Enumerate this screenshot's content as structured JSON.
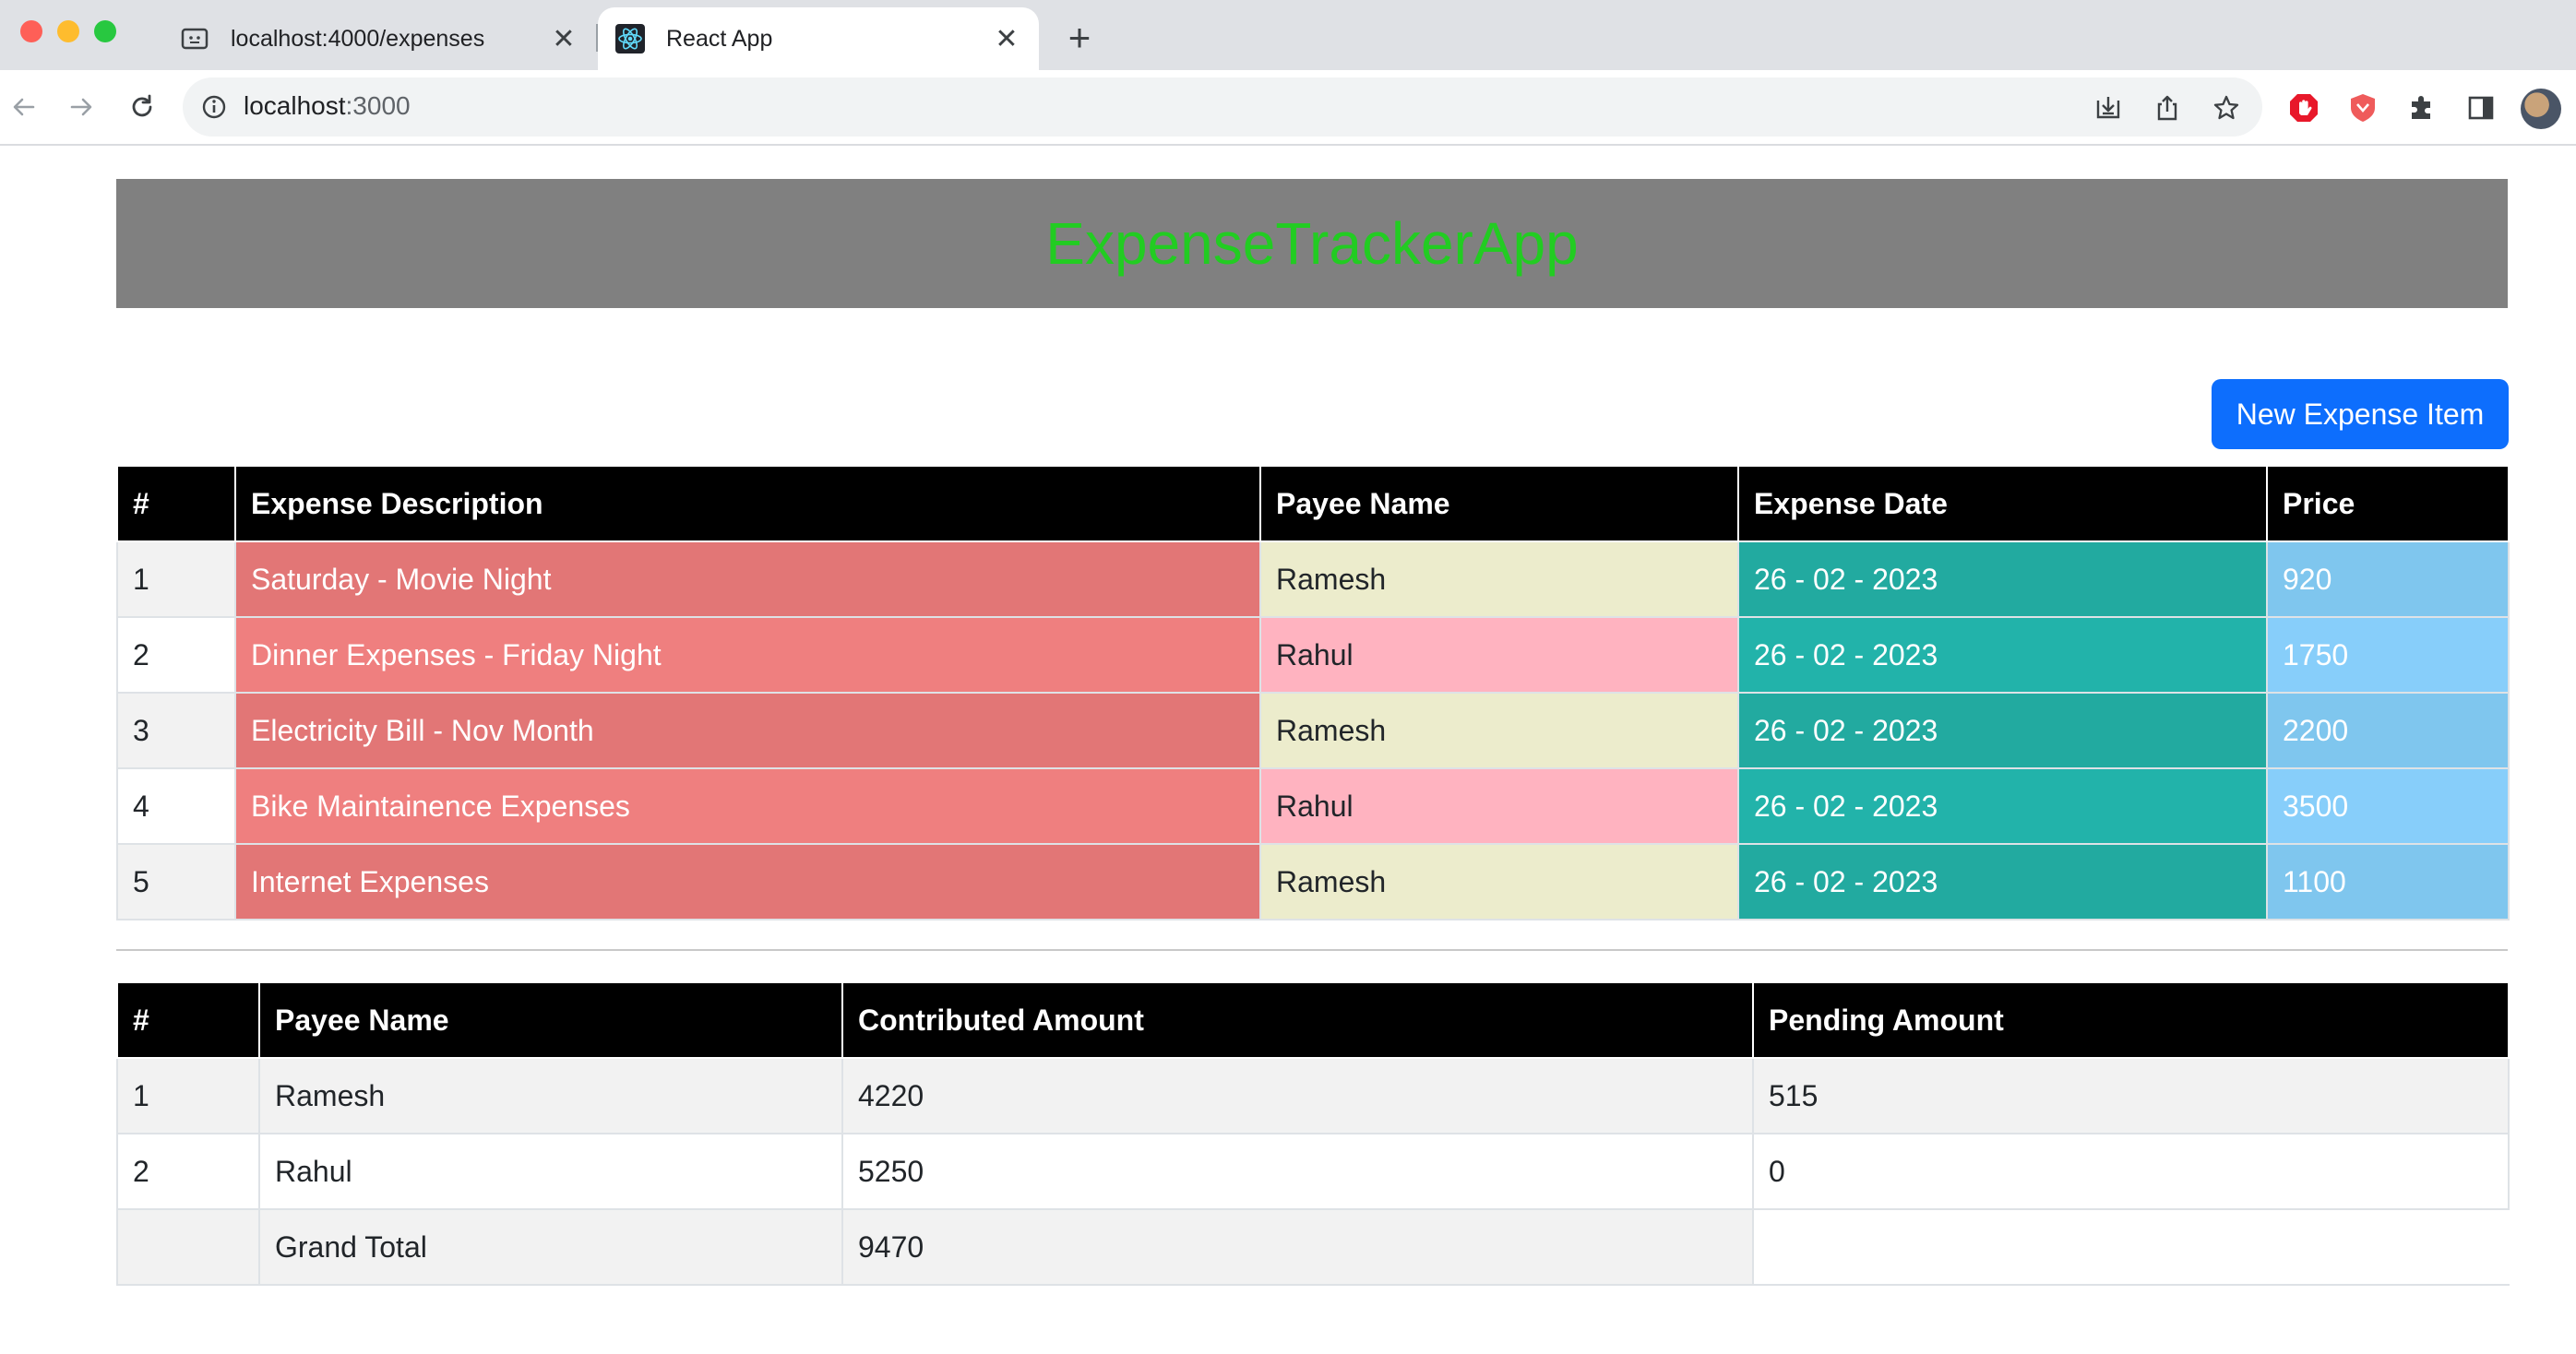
{
  "browser": {
    "tabs": [
      {
        "title": "localhost:4000/expenses",
        "favicon": "json-doc-icon",
        "active": false
      },
      {
        "title": "React App",
        "favicon": "react-icon",
        "active": true
      }
    ],
    "url_host": "localhost",
    "url_port": ":3000"
  },
  "app": {
    "title": "ExpenseTrackerApp",
    "title_color": "#22cc22",
    "header_bg": "#808080",
    "new_button_label": "New Expense Item",
    "accent": "#0d6efd"
  },
  "expenses": {
    "headers": [
      "#",
      "Expense Description",
      "Payee Name",
      "Expense Date",
      "Price"
    ],
    "rows": [
      {
        "num": "1",
        "desc": "Saturday - Movie Night",
        "payee": "Ramesh",
        "date": "26 - 02 - 2023",
        "price": "920"
      },
      {
        "num": "2",
        "desc": "Dinner Expenses - Friday Night",
        "payee": "Rahul",
        "date": "26 - 02 - 2023",
        "price": "1750"
      },
      {
        "num": "3",
        "desc": "Electricity Bill - Nov Month",
        "payee": "Ramesh",
        "date": "26 - 02 - 2023",
        "price": "2200"
      },
      {
        "num": "4",
        "desc": "Bike Maintainence Expenses",
        "payee": "Rahul",
        "date": "26 - 02 - 2023",
        "price": "3500"
      },
      {
        "num": "5",
        "desc": "Internet Expenses",
        "payee": "Ramesh",
        "date": "26 - 02 - 2023",
        "price": "1100"
      }
    ]
  },
  "summary": {
    "headers": [
      "#",
      "Payee Name",
      "Contributed Amount",
      "Pending Amount"
    ],
    "rows": [
      {
        "num": "1",
        "payee": "Ramesh",
        "contributed": "4220",
        "pending": "515"
      },
      {
        "num": "2",
        "payee": "Rahul",
        "contributed": "5250",
        "pending": "0"
      }
    ],
    "total": {
      "label": "Grand Total",
      "amount": "9470"
    }
  }
}
